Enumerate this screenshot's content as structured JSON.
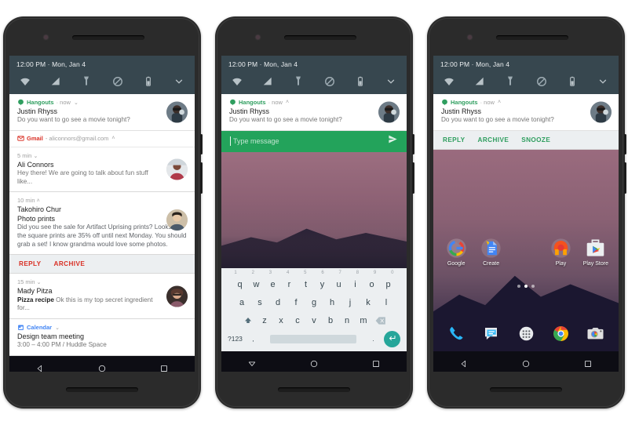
{
  "statusbar": {
    "time": "12:00 PM",
    "separator": "·",
    "date": "Mon, Jan 4"
  },
  "quick_settings": {
    "icons": [
      "wifi-icon",
      "signal-icon",
      "flashlight-icon",
      "do-not-disturb-icon",
      "battery-icon",
      "chevron-down-icon"
    ]
  },
  "hangouts": {
    "app": "Hangouts",
    "sub": "· now",
    "chevron_down": "⌄",
    "chevron_up": "˄",
    "sender": "Justin Rhyss",
    "message": "Do you want to go see a movie tonight?",
    "accent": "#2f9e5f"
  },
  "phone1": {
    "gmail": {
      "app": "Gmail",
      "account": "- aliconnors@gmail.com",
      "chevron": "˄",
      "accent": "#d93025",
      "items": [
        {
          "time": "5 min",
          "chev": "⌄",
          "sender": "Ali Connors",
          "preview": "Hey there! We are going to talk about fun stuff like..."
        },
        {
          "time": "10 min",
          "chev": "˄",
          "sender": "Takohiro Chur",
          "subject": "Photo prints",
          "body": "Did you see the sale for Artifact Uprising prints? Looks like the square prints are 35% off until next Monday. You should grab a set! I know grandma would love some photos."
        },
        {
          "time": "15 min",
          "chev": "⌄",
          "sender": "Mady Pitza",
          "subject": "Pizza recipe",
          "preview": "Ok this is my top secret ingredient for..."
        }
      ],
      "actions": [
        "REPLY",
        "ARCHIVE"
      ]
    },
    "calendar": {
      "app": "Calendar",
      "chevron": "⌄",
      "accent": "#4285f4",
      "title": "Design team meeting",
      "detail": "3:00 – 4:00 PM / Huddle Space"
    }
  },
  "phone2": {
    "reply": {
      "placeholder": "Type message",
      "send": "send-icon"
    },
    "keyboard": {
      "numbers": [
        "1",
        "2",
        "3",
        "4",
        "5",
        "6",
        "7",
        "8",
        "9",
        "0"
      ],
      "row1": [
        "q",
        "w",
        "e",
        "r",
        "t",
        "y",
        "u",
        "i",
        "o",
        "p"
      ],
      "row2": [
        "a",
        "s",
        "d",
        "f",
        "g",
        "h",
        "j",
        "k",
        "l"
      ],
      "row3": [
        "z",
        "x",
        "c",
        "v",
        "b",
        "n",
        "m"
      ],
      "shift": "shift-icon",
      "backspace": "backspace-icon",
      "symbols": "?123",
      "comma": ",",
      "period": ".",
      "enter": "enter-icon"
    }
  },
  "phone3": {
    "actions": [
      "REPLY",
      "ARCHIVE",
      "SNOOZE"
    ],
    "home": {
      "apps": [
        {
          "label": "Google",
          "icon": "google-icon"
        },
        {
          "label": "Create",
          "icon": "create-icon"
        },
        {
          "label": "",
          "icon": "blank-icon"
        },
        {
          "label": "Play",
          "icon": "play-music-icon"
        },
        {
          "label": "Play Store",
          "icon": "play-store-icon"
        }
      ],
      "page_dots": 3,
      "active_dot": 2,
      "dock": [
        {
          "label": "",
          "icon": "phone-icon"
        },
        {
          "label": "",
          "icon": "messages-icon"
        },
        {
          "label": "",
          "icon": "app-drawer-icon"
        },
        {
          "label": "",
          "icon": "chrome-icon"
        },
        {
          "label": "",
          "icon": "camera-icon"
        }
      ]
    }
  },
  "navbar": {
    "back": "back-icon",
    "home": "home-icon",
    "recents": "recents-icon"
  }
}
